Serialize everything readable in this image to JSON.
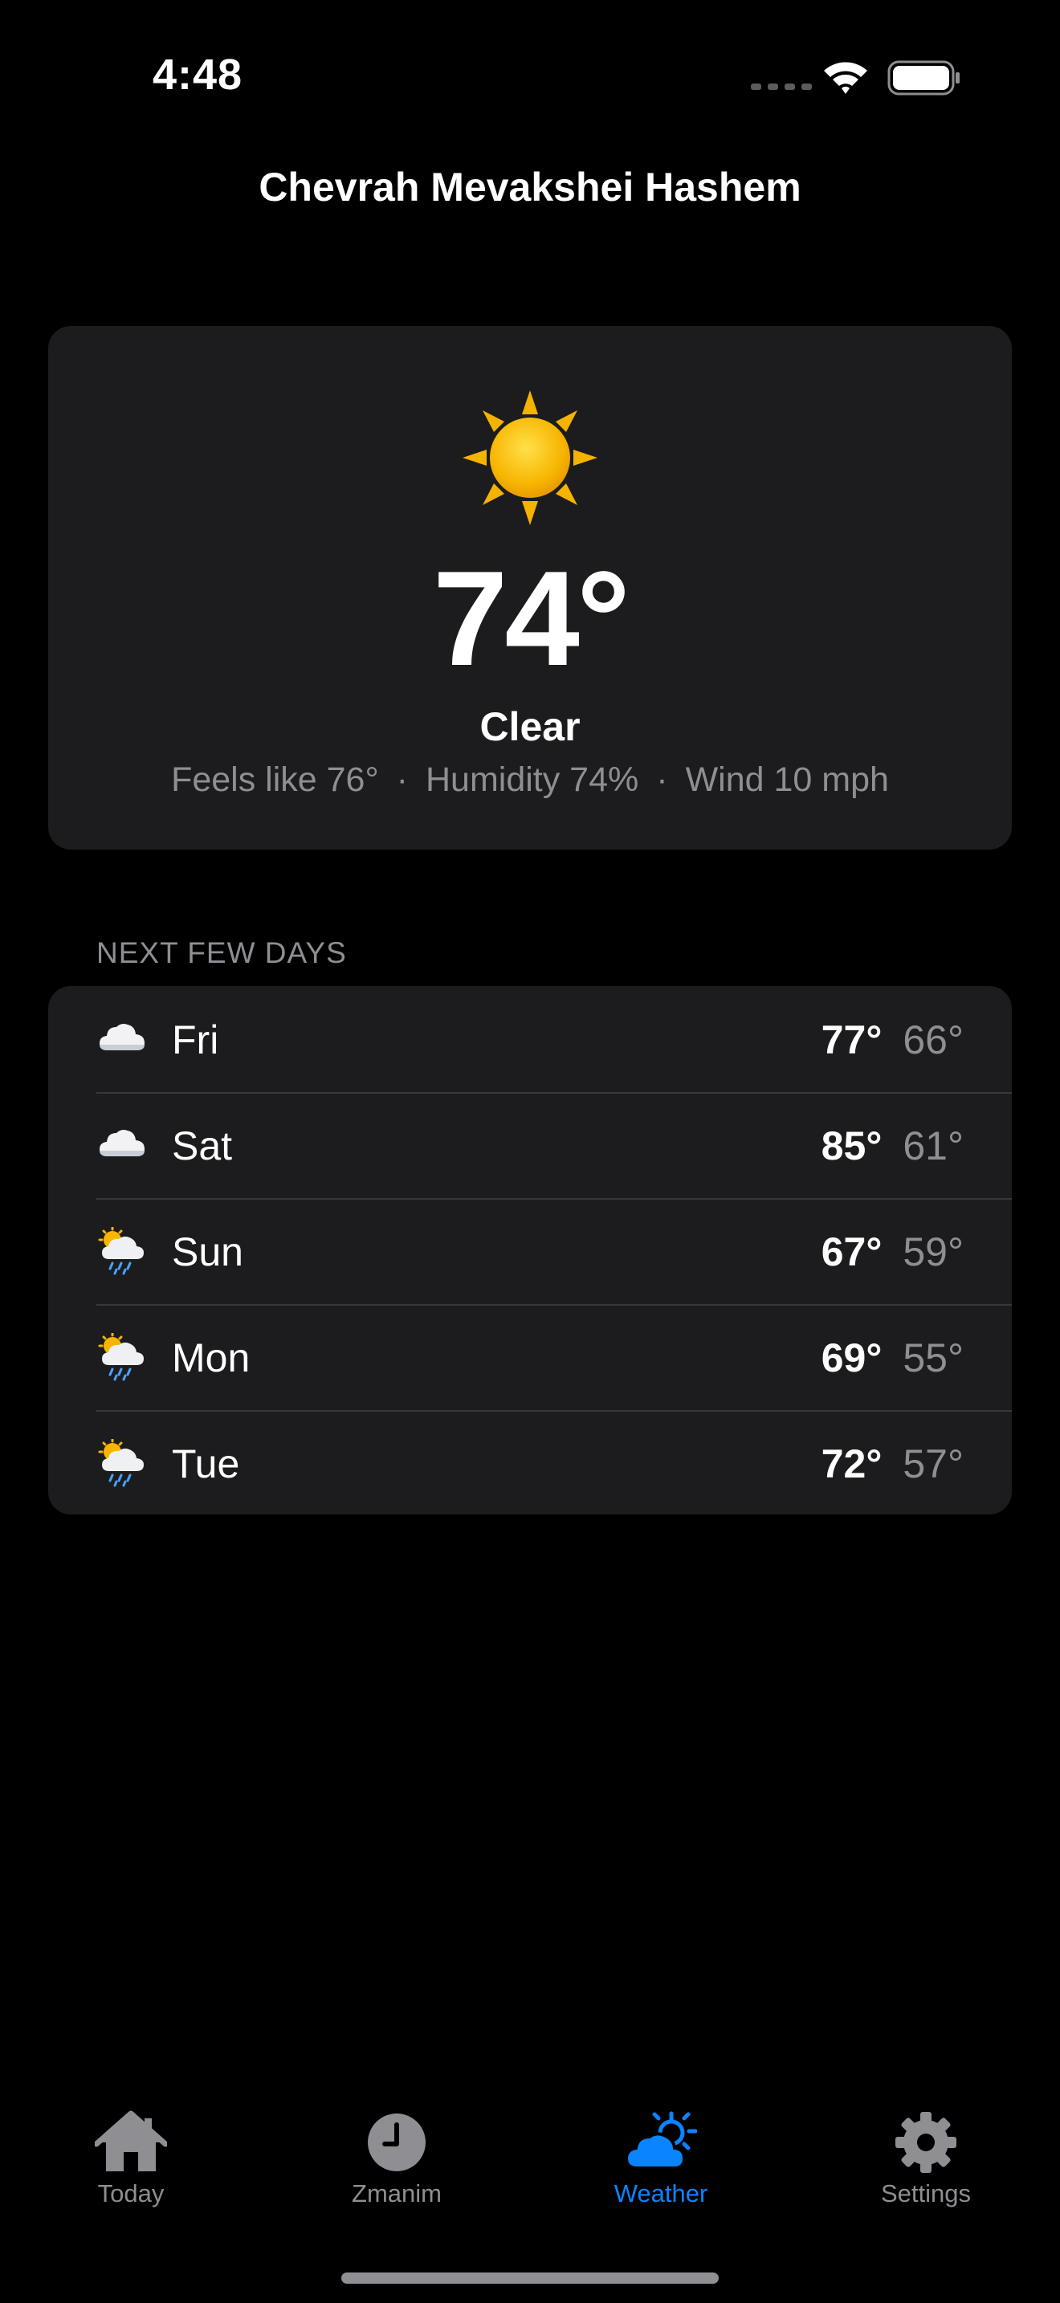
{
  "status_bar": {
    "time": "4:48"
  },
  "header": {
    "title": "Chevrah Mevakshei Hashem"
  },
  "current": {
    "icon": "sun-icon",
    "temperature": "74°",
    "condition": "Clear",
    "feels_like": "Feels like 76°",
    "humidity": "Humidity 74%",
    "wind": "Wind 10 mph",
    "separator": "·"
  },
  "forecast": {
    "section_title": "NEXT FEW DAYS",
    "days": [
      {
        "day": "Fri",
        "icon": "cloud-icon",
        "high": "77°",
        "low": "66°"
      },
      {
        "day": "Sat",
        "icon": "cloud-icon",
        "high": "85°",
        "low": "61°"
      },
      {
        "day": "Sun",
        "icon": "sun-behind-rain-cloud-icon",
        "high": "67°",
        "low": "59°"
      },
      {
        "day": "Mon",
        "icon": "sun-behind-rain-cloud-icon",
        "high": "69°",
        "low": "55°"
      },
      {
        "day": "Tue",
        "icon": "sun-behind-rain-cloud-icon",
        "high": "72°",
        "low": "57°"
      }
    ]
  },
  "tab_bar": {
    "tabs": [
      {
        "label": "Today",
        "icon": "house-icon",
        "active": false
      },
      {
        "label": "Zmanim",
        "icon": "clock-icon",
        "active": false
      },
      {
        "label": "Weather",
        "icon": "cloud-sun-icon",
        "active": true
      },
      {
        "label": "Settings",
        "icon": "gear-icon",
        "active": false
      }
    ],
    "active_color": "#0a84ff",
    "inactive_color": "#8e8e93"
  },
  "colors": {
    "background": "#000000",
    "card": "#1c1c1e",
    "secondary_text": "#8e8e93"
  }
}
